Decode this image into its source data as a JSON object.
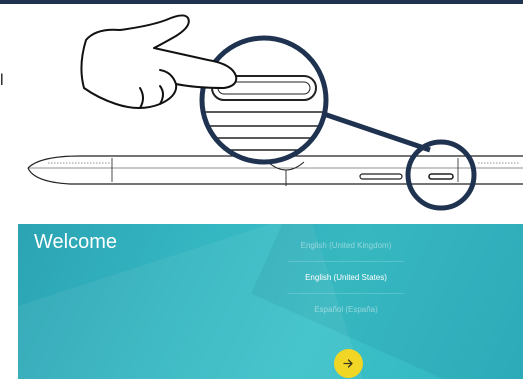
{
  "setup": {
    "welcome_title": "Welcome",
    "languages": [
      {
        "label": "English (United Kingdom)",
        "selected": false
      },
      {
        "label": "English (United States)",
        "selected": true
      },
      {
        "label": "Español (España)",
        "selected": false
      }
    ],
    "next_icon": "arrow-right-icon",
    "accent_color": "#f2d626",
    "background_color": "#35b7c2"
  },
  "illustration": {
    "description_icons": [
      "pointing-hand-icon",
      "magnifier-circle-icon",
      "tablet-device-icon",
      "power-button-icon"
    ],
    "frame_color": "#1f3350"
  }
}
